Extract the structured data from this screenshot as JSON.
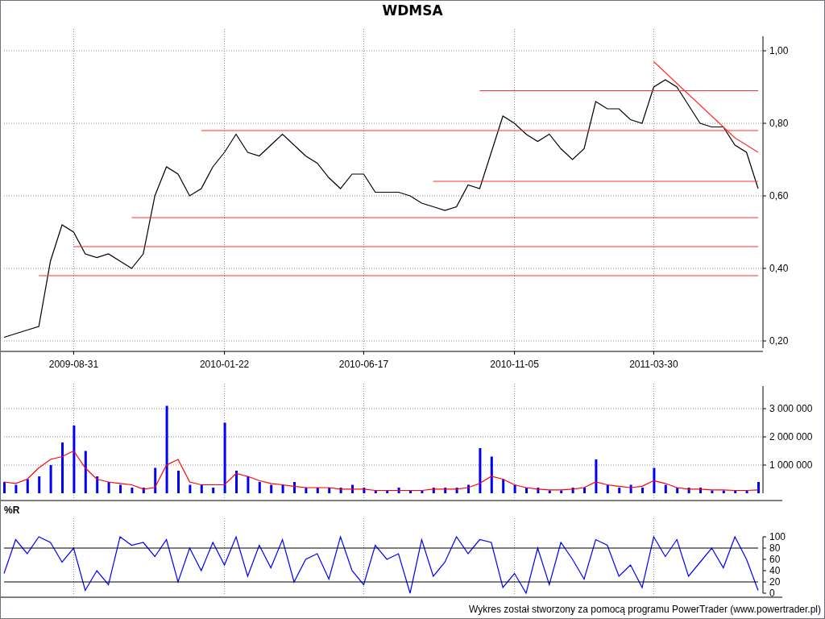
{
  "title": "WDMSA",
  "price_panel": {
    "chart_data": {
      "type": "line",
      "grid": true,
      "ylim": [
        0.18,
        1.04
      ],
      "categories": [
        null,
        null,
        null,
        null,
        null,
        null,
        "2009-08-31",
        null,
        null,
        null,
        null,
        null,
        null,
        null,
        null,
        null,
        null,
        null,
        null,
        "2010-01-22",
        null,
        null,
        null,
        null,
        null,
        null,
        null,
        null,
        null,
        null,
        null,
        "2010-06-17",
        null,
        null,
        null,
        null,
        null,
        null,
        null,
        null,
        null,
        null,
        null,
        null,
        "2010-11-05",
        null,
        null,
        null,
        null,
        null,
        null,
        null,
        null,
        null,
        null,
        null,
        "2011-03-30",
        null,
        null,
        null,
        null,
        null,
        null,
        null,
        null,
        null
      ],
      "series": [
        {
          "color": "#000000",
          "values": [
            0.21,
            0.22,
            0.23,
            0.24,
            0.42,
            0.52,
            0.5,
            0.44,
            0.43,
            0.44,
            0.42,
            0.4,
            0.44,
            0.6,
            0.68,
            0.66,
            0.6,
            0.62,
            0.68,
            0.72,
            0.77,
            0.72,
            0.71,
            0.74,
            0.77,
            0.74,
            0.71,
            0.69,
            0.65,
            0.62,
            0.66,
            0.66,
            0.61,
            0.61,
            0.61,
            0.6,
            0.58,
            0.57,
            0.56,
            0.57,
            0.63,
            0.62,
            0.72,
            0.82,
            0.8,
            0.77,
            0.75,
            0.77,
            0.73,
            0.7,
            0.73,
            0.86,
            0.84,
            0.84,
            0.81,
            0.8,
            0.9,
            0.92,
            0.9,
            0.85,
            0.8,
            0.79,
            0.79,
            0.74,
            0.72,
            0.62
          ]
        },
        {
          "color": "#ff3030",
          "values": [
            null,
            null,
            null,
            null,
            null,
            null,
            null,
            null,
            null,
            null,
            null,
            null,
            null,
            null,
            null,
            null,
            null,
            null,
            null,
            null,
            null,
            null,
            null,
            null,
            null,
            null,
            null,
            null,
            null,
            null,
            null,
            null,
            null,
            null,
            null,
            null,
            null,
            null,
            null,
            null,
            null,
            0.89,
            0.89,
            0.89,
            0.89,
            0.89,
            0.89,
            0.89,
            0.89,
            0.89,
            0.89,
            0.89,
            0.89,
            0.89,
            0.89,
            0.89,
            0.89,
            0.89,
            0.89,
            0.89,
            0.89,
            0.89,
            0.89,
            0.89,
            0.89,
            0.89
          ]
        },
        {
          "color": "#ff3030",
          "values": [
            null,
            null,
            null,
            null,
            null,
            null,
            null,
            null,
            null,
            null,
            null,
            null,
            null,
            null,
            null,
            null,
            null,
            0.78,
            0.78,
            0.78,
            0.78,
            0.78,
            0.78,
            0.78,
            0.78,
            0.78,
            0.78,
            0.78,
            0.78,
            0.78,
            0.78,
            0.78,
            0.78,
            0.78,
            0.78,
            0.78,
            0.78,
            0.78,
            0.78,
            0.78,
            0.78,
            0.78,
            0.78,
            0.78,
            0.78,
            0.78,
            0.78,
            0.78,
            0.78,
            0.78,
            0.78,
            0.78,
            0.78,
            0.78,
            0.78,
            0.78,
            0.78,
            0.78,
            0.78,
            0.78,
            0.78,
            0.78,
            0.78,
            0.78,
            0.78,
            0.78
          ]
        },
        {
          "color": "#ff3030",
          "values": [
            null,
            null,
            null,
            null,
            null,
            null,
            null,
            null,
            null,
            null,
            null,
            null,
            null,
            null,
            null,
            null,
            null,
            null,
            null,
            null,
            null,
            null,
            null,
            null,
            null,
            null,
            null,
            null,
            null,
            null,
            null,
            null,
            null,
            null,
            null,
            null,
            null,
            0.64,
            0.64,
            0.64,
            0.64,
            0.64,
            0.64,
            0.64,
            0.64,
            0.64,
            0.64,
            0.64,
            0.64,
            0.64,
            0.64,
            0.64,
            0.64,
            0.64,
            0.64,
            0.64,
            0.64,
            0.64,
            0.64,
            0.64,
            0.64,
            0.64,
            0.64,
            0.64,
            0.64,
            0.64
          ]
        },
        {
          "color": "#ff3030",
          "values": [
            null,
            null,
            null,
            null,
            null,
            null,
            null,
            null,
            null,
            null,
            null,
            0.54,
            0.54,
            0.54,
            0.54,
            0.54,
            0.54,
            0.54,
            0.54,
            0.54,
            0.54,
            0.54,
            0.54,
            0.54,
            0.54,
            0.54,
            0.54,
            0.54,
            0.54,
            0.54,
            0.54,
            0.54,
            0.54,
            0.54,
            0.54,
            0.54,
            0.54,
            0.54,
            0.54,
            0.54,
            0.54,
            0.54,
            0.54,
            0.54,
            0.54,
            0.54,
            0.54,
            0.54,
            0.54,
            0.54,
            0.54,
            0.54,
            0.54,
            0.54,
            0.54,
            0.54,
            0.54,
            0.54,
            0.54,
            0.54,
            0.54,
            0.54,
            0.54,
            0.54,
            0.54,
            0.54
          ]
        },
        {
          "color": "#ff3030",
          "values": [
            null,
            null,
            null,
            null,
            null,
            null,
            0.46,
            0.46,
            0.46,
            0.46,
            0.46,
            0.46,
            0.46,
            0.46,
            0.46,
            0.46,
            0.46,
            0.46,
            0.46,
            0.46,
            0.46,
            0.46,
            0.46,
            0.46,
            0.46,
            0.46,
            0.46,
            0.46,
            0.46,
            0.46,
            0.46,
            0.46,
            0.46,
            0.46,
            0.46,
            0.46,
            0.46,
            0.46,
            0.46,
            0.46,
            0.46,
            0.46,
            0.46,
            0.46,
            0.46,
            0.46,
            0.46,
            0.46,
            0.46,
            0.46,
            0.46,
            0.46,
            0.46,
            0.46,
            0.46,
            0.46,
            0.46,
            0.46,
            0.46,
            0.46,
            0.46,
            0.46,
            0.46,
            0.46,
            0.46,
            0.46
          ]
        },
        {
          "color": "#ff3030",
          "values": [
            null,
            null,
            null,
            0.38,
            0.38,
            0.38,
            0.38,
            0.38,
            0.38,
            0.38,
            0.38,
            0.38,
            0.38,
            0.38,
            0.38,
            0.38,
            0.38,
            0.38,
            0.38,
            0.38,
            0.38,
            0.38,
            0.38,
            0.38,
            0.38,
            0.38,
            0.38,
            0.38,
            0.38,
            0.38,
            0.38,
            0.38,
            0.38,
            0.38,
            0.38,
            0.38,
            0.38,
            0.38,
            0.38,
            0.38,
            0.38,
            0.38,
            0.38,
            0.38,
            0.38,
            0.38,
            0.38,
            0.38,
            0.38,
            0.38,
            0.38,
            0.38,
            0.38,
            0.38,
            0.38,
            0.38,
            0.38,
            0.38,
            0.38,
            0.38,
            0.38,
            0.38,
            0.38,
            0.38,
            0.38,
            0.38
          ]
        },
        {
          "color": "#ff3030",
          "values": [
            null,
            null,
            null,
            null,
            null,
            null,
            null,
            null,
            null,
            null,
            null,
            null,
            null,
            null,
            null,
            null,
            null,
            null,
            null,
            null,
            null,
            null,
            null,
            null,
            null,
            null,
            null,
            null,
            null,
            null,
            null,
            null,
            null,
            null,
            null,
            null,
            null,
            null,
            null,
            null,
            null,
            null,
            null,
            null,
            null,
            null,
            null,
            null,
            null,
            null,
            null,
            null,
            null,
            null,
            null,
            null,
            0.97,
            0.94,
            0.91,
            0.88,
            0.85,
            0.82,
            0.79,
            0.76,
            0.74,
            0.72
          ]
        }
      ],
      "yticks": [
        {
          "value": 0.2,
          "label": "0,20"
        },
        {
          "value": 0.4,
          "label": "0,40"
        },
        {
          "value": 0.6,
          "label": "0,60"
        },
        {
          "value": 0.8,
          "label": "0,80"
        },
        {
          "value": 1.0,
          "label": "1,00"
        }
      ]
    }
  },
  "volume_panel": {
    "chart_data": {
      "type": "bar",
      "grid": true,
      "ylim": [
        0,
        3800000
      ],
      "categories": [
        null,
        null,
        null,
        null,
        null,
        null,
        null,
        null,
        null,
        null,
        null,
        null,
        null,
        null,
        null,
        null,
        null,
        null,
        null,
        null,
        null,
        null,
        null,
        null,
        null,
        null,
        null,
        null,
        null,
        null,
        null,
        null,
        null,
        null,
        null,
        null,
        null,
        null,
        null,
        null,
        null,
        null,
        null,
        null,
        null,
        null,
        null,
        null,
        null,
        null,
        null,
        null,
        null,
        null,
        null,
        null,
        null,
        null,
        null,
        null,
        null,
        null,
        null,
        null,
        null,
        null
      ],
      "series": [
        {
          "color": "#0000ff",
          "values": [
            400000,
            300000,
            500000,
            600000,
            1000000,
            1800000,
            2400000,
            1500000,
            600000,
            400000,
            300000,
            200000,
            200000,
            900000,
            3100000,
            800000,
            300000,
            300000,
            200000,
            2500000,
            800000,
            600000,
            400000,
            300000,
            300000,
            400000,
            200000,
            200000,
            200000,
            200000,
            300000,
            200000,
            100000,
            100000,
            200000,
            100000,
            100000,
            200000,
            200000,
            200000,
            300000,
            1600000,
            1300000,
            500000,
            300000,
            200000,
            200000,
            100000,
            100000,
            200000,
            200000,
            1200000,
            300000,
            200000,
            300000,
            200000,
            900000,
            300000,
            200000,
            200000,
            200000,
            100000,
            100000,
            100000,
            100000,
            400000
          ]
        },
        {
          "type": "line",
          "color": "#ff0000",
          "values": [
            400000,
            350000,
            500000,
            900000,
            1200000,
            1300000,
            1500000,
            900000,
            500000,
            400000,
            350000,
            300000,
            150000,
            200000,
            1000000,
            1200000,
            400000,
            300000,
            300000,
            300000,
            700000,
            600000,
            450000,
            350000,
            300000,
            250000,
            200000,
            200000,
            200000,
            150000,
            150000,
            150000,
            100000,
            100000,
            100000,
            100000,
            100000,
            150000,
            150000,
            150000,
            200000,
            350000,
            600000,
            500000,
            300000,
            200000,
            150000,
            120000,
            120000,
            150000,
            200000,
            400000,
            300000,
            250000,
            200000,
            250000,
            450000,
            350000,
            200000,
            150000,
            150000,
            120000,
            120000,
            100000,
            100000,
            120000
          ]
        }
      ],
      "yticks": [
        {
          "value": 1000000,
          "label": "1 000 000"
        },
        {
          "value": 2000000,
          "label": "2 000 000"
        },
        {
          "value": 3000000,
          "label": "3 000 000"
        }
      ]
    }
  },
  "williams_panel": {
    "label": "%R",
    "chart_data": {
      "type": "line",
      "grid": true,
      "ylim": [
        0,
        100
      ],
      "categories": [
        null,
        null,
        null,
        null,
        null,
        null,
        null,
        null,
        null,
        null,
        null,
        null,
        null,
        null,
        null,
        null,
        null,
        null,
        null,
        null,
        null,
        null,
        null,
        null,
        null,
        null,
        null,
        null,
        null,
        null,
        null,
        null,
        null,
        null,
        null,
        null,
        null,
        null,
        null,
        null,
        null,
        null,
        null,
        null,
        null,
        null,
        null,
        null,
        null,
        null,
        null,
        null,
        null,
        null,
        null,
        null,
        null,
        null,
        null,
        null,
        null,
        null,
        null,
        null,
        null,
        null
      ],
      "series": [
        {
          "color": "#0000ff",
          "values": [
            35,
            95,
            70,
            100,
            90,
            55,
            80,
            5,
            40,
            15,
            100,
            85,
            90,
            65,
            95,
            20,
            80,
            40,
            90,
            50,
            100,
            30,
            85,
            45,
            95,
            20,
            60,
            70,
            25,
            100,
            40,
            15,
            85,
            60,
            70,
            0,
            95,
            30,
            55,
            100,
            70,
            95,
            90,
            10,
            35,
            0,
            80,
            15,
            90,
            60,
            25,
            95,
            85,
            30,
            50,
            10,
            100,
            65,
            95,
            30,
            55,
            80,
            45,
            100,
            60,
            5
          ]
        },
        {
          "color": "#000000",
          "values": [
            80,
            80,
            80,
            80,
            80,
            80,
            80,
            80,
            80,
            80,
            80,
            80,
            80,
            80,
            80,
            80,
            80,
            80,
            80,
            80,
            80,
            80,
            80,
            80,
            80,
            80,
            80,
            80,
            80,
            80,
            80,
            80,
            80,
            80,
            80,
            80,
            80,
            80,
            80,
            80,
            80,
            80,
            80,
            80,
            80,
            80,
            80,
            80,
            80,
            80,
            80,
            80,
            80,
            80,
            80,
            80,
            80,
            80,
            80,
            80,
            80,
            80,
            80,
            80,
            80,
            80
          ]
        },
        {
          "color": "#000000",
          "values": [
            20,
            20,
            20,
            20,
            20,
            20,
            20,
            20,
            20,
            20,
            20,
            20,
            20,
            20,
            20,
            20,
            20,
            20,
            20,
            20,
            20,
            20,
            20,
            20,
            20,
            20,
            20,
            20,
            20,
            20,
            20,
            20,
            20,
            20,
            20,
            20,
            20,
            20,
            20,
            20,
            20,
            20,
            20,
            20,
            20,
            20,
            20,
            20,
            20,
            20,
            20,
            20,
            20,
            20,
            20,
            20,
            20,
            20,
            20,
            20,
            20,
            20,
            20,
            20,
            20,
            20
          ]
        }
      ],
      "yticks": [
        0,
        20,
        40,
        60,
        80,
        100
      ]
    }
  },
  "footer": "Wykres został stworzony za pomocą programu PowerTrader (www.powertrader.pl)"
}
